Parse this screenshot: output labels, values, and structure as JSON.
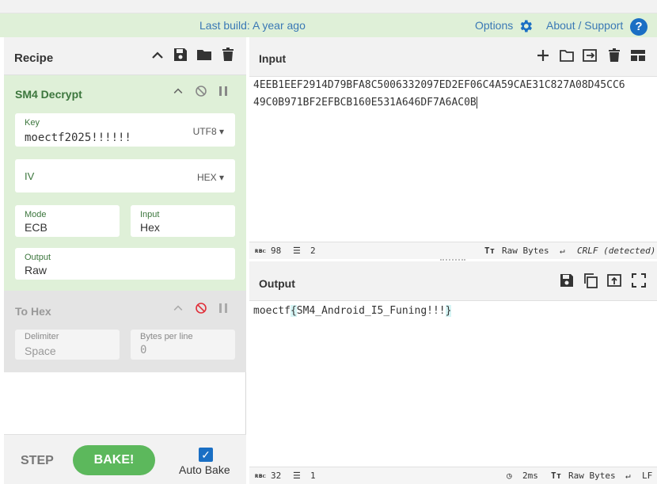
{
  "banner": {
    "last_build": "Last build: A year ago",
    "options": "Options",
    "about": "About / Support",
    "help": "?"
  },
  "recipe": {
    "title": "Recipe",
    "sm4": {
      "title": "SM4 Decrypt",
      "key": {
        "label": "Key",
        "value": "moectf2025!!!!!!",
        "encoding": "UTF8"
      },
      "iv": {
        "label": "IV",
        "value": "",
        "encoding": "HEX"
      },
      "mode": {
        "label": "Mode",
        "value": "ECB"
      },
      "input": {
        "label": "Input",
        "value": "Hex"
      },
      "output": {
        "label": "Output",
        "value": "Raw"
      }
    },
    "tohex": {
      "title": "To Hex",
      "delimiter": {
        "label": "Delimiter",
        "value": "Space"
      },
      "bytes_per_line": {
        "label": "Bytes per line",
        "value": "0"
      }
    },
    "step": "STEP",
    "bake": "BAKE!",
    "auto_bake": "Auto Bake",
    "auto_bake_checked": true
  },
  "input": {
    "title": "Input",
    "line1": "4EEB1EEF2914D79BFA8C5006332097ED2EF06C4A59CAE31C827A08D45CC6",
    "line2": "49C0B971BF2EFBCB160E531A646DF7A6AC0B",
    "status": {
      "chars": "98",
      "lines": "2",
      "encoding": "Raw Bytes",
      "eol": "CRLF (detected)"
    }
  },
  "output": {
    "title": "Output",
    "prefix": "moectf",
    "brace_open": "{",
    "body": "SM4_Android_I5_Funing!!!",
    "brace_close": "}",
    "status": {
      "chars": "32",
      "lines": "1",
      "time": "2ms",
      "encoding": "Raw Bytes",
      "eol": "LF"
    }
  },
  "colors": {
    "accent": "#1a6fc4",
    "bake": "#5cb85c",
    "op_active_bg": "#dff0d8",
    "op_disabled_bg": "#e4e4e4",
    "disabled_icon": "#e0303a"
  }
}
